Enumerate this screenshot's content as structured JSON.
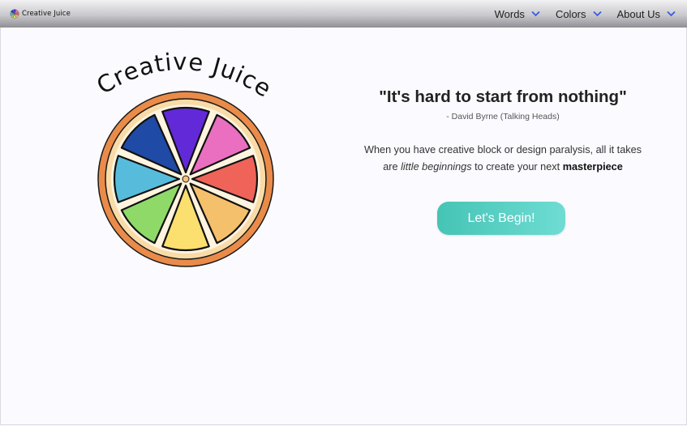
{
  "navbar": {
    "brand": {
      "logo_icon": "orange-slice-icon",
      "name": "Creative Juice"
    },
    "items": [
      {
        "label": "Words",
        "icon": "chevron-down-icon"
      },
      {
        "label": "Colors",
        "icon": "chevron-down-icon"
      },
      {
        "label": "About Us",
        "icon": "chevron-down-icon"
      }
    ]
  },
  "hero": {
    "logo_title": "Creative Juice",
    "logo_icon": "orange-slice-icon",
    "quote": "\"It's hard to start from nothing\"",
    "attribution": "- David Byrne (Talking Heads)",
    "description": {
      "part1": "When you have creative block or design paralysis, all it takes are ",
      "emphasis": "little beginnings",
      "part2": " to create your next ",
      "strong": "masterpiece"
    },
    "cta_label": "Let's Begin!"
  },
  "colors": {
    "accent": "#45c4b5",
    "accent_end": "#6fdcd4",
    "nav_chevron": "#3b5bdb",
    "page_background": "#fbfaff",
    "slices": [
      "#6229d9",
      "#ea6fc1",
      "#ef6358",
      "#f5c06b",
      "#fbe06f",
      "#8fd969",
      "#57bcdc",
      "#1f4aa5"
    ]
  }
}
